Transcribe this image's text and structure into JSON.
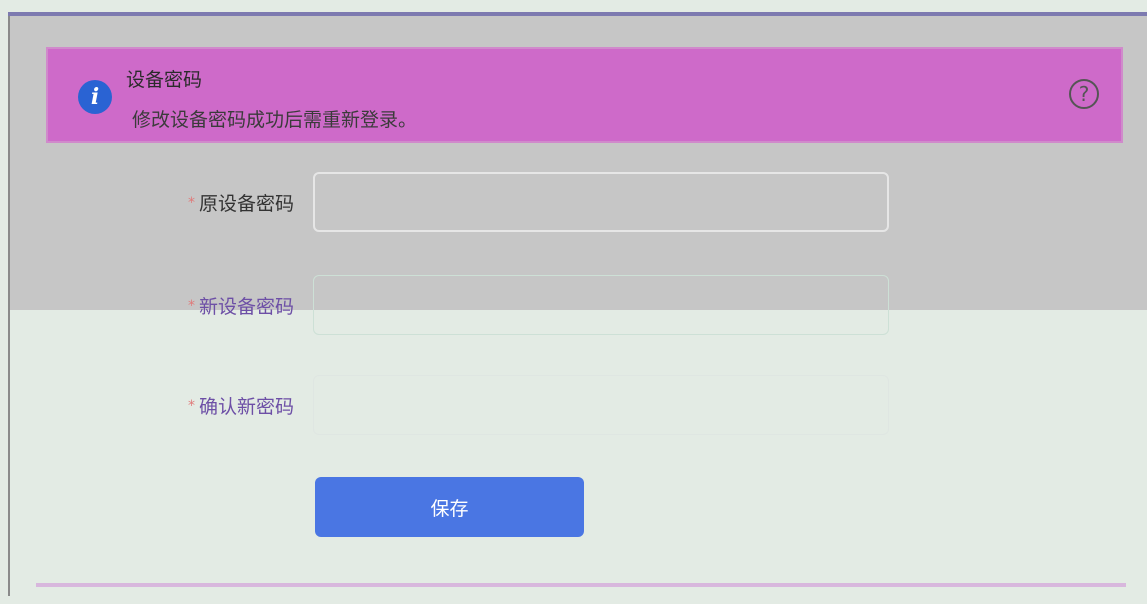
{
  "banner": {
    "icon": "info-icon",
    "title": "设备密码",
    "description": "修改设备密码成功后需重新登录。",
    "help_icon": "question-circle-icon"
  },
  "form": {
    "fields": [
      {
        "required_mark": "*",
        "label": "原设备密码",
        "value": "",
        "placeholder": ""
      },
      {
        "required_mark": "*",
        "label": "新设备密码",
        "value": "",
        "placeholder": ""
      },
      {
        "required_mark": "*",
        "label": "确认新密码",
        "value": "",
        "placeholder": ""
      }
    ],
    "save_label": "保存"
  },
  "colors": {
    "banner_bg": "#ce6ac9",
    "info_icon": "#2a63d3",
    "primary_button": "#4a76e3",
    "required": "#e07a7a"
  }
}
